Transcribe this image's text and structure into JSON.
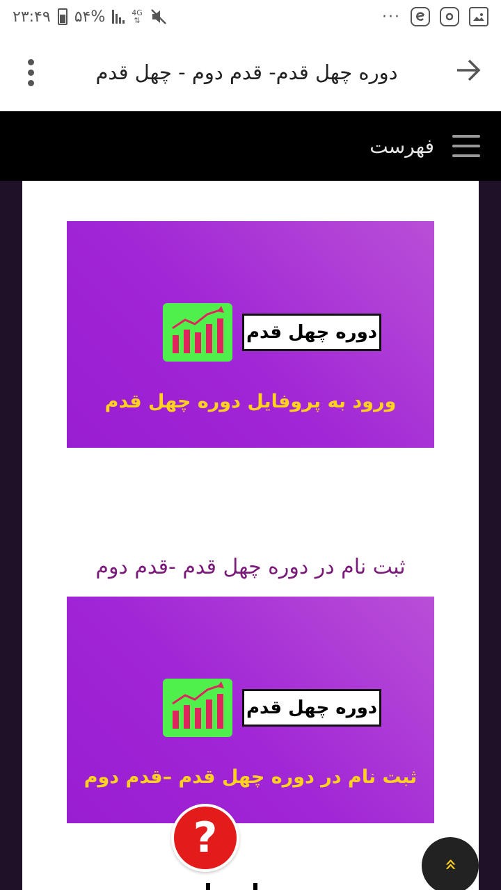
{
  "status_bar": {
    "time": "۲۳:۴۹",
    "battery": "۵۴%",
    "network": "4G",
    "icons": [
      "battery-icon",
      "signal-icon",
      "mute-icon",
      "more-icon",
      "eitaa-icon",
      "instagram-icon",
      "gallery-icon"
    ]
  },
  "browser": {
    "title": "دوره چهل قدم- قدم دوم - چهل قدم",
    "back_icon": "arrow-right-icon",
    "menu_icon": "kebab-menu-icon"
  },
  "site_nav": {
    "menu_label": "فهرست"
  },
  "banners": [
    {
      "brand": "دوره چهل قدم",
      "cta": "ورود به پروفایل دوره چهل قدم"
    },
    {
      "brand": "دوره چهل قدم",
      "cta": "ثبت نام در دوره چهل قدم –قدم دوم"
    }
  ],
  "section": {
    "heading": "ثبت نام در دوره چهل قدم -قدم دوم"
  },
  "floating": {
    "help_label": "?",
    "scroll_top_label": "»"
  },
  "colors": {
    "banner_purple": "#a126d6",
    "cta_yellow": "#ffd21f",
    "chart_green": "#4ff04b",
    "heading_purple": "#7a1b7a",
    "help_red": "#e31b1b",
    "nav_black": "#000000"
  }
}
